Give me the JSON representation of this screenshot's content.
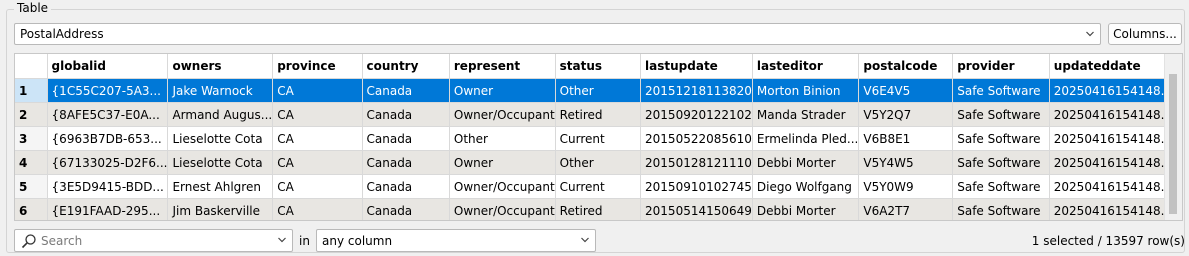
{
  "group_title": "Table",
  "layer_select": {
    "value": "PostalAddress"
  },
  "columns_button": "Columns...",
  "table": {
    "columns": [
      "globalid",
      "owners",
      "province",
      "country",
      "represent",
      "status",
      "lastupdate",
      "lasteditor",
      "postalcode",
      "provider",
      "updateddate"
    ],
    "rows": [
      {
        "num": "1",
        "cells": [
          "{1C55C207-5A3...",
          "Jake Warnock",
          "CA",
          "Canada",
          "Owner",
          "Other",
          "20151218113820",
          "Morton Binion",
          "V6E4V5",
          "Safe Software",
          "20250416154148...."
        ]
      },
      {
        "num": "2",
        "cells": [
          "{8AFE5C37-E0A...",
          "Armand Augus...",
          "CA",
          "Canada",
          "Owner/Occupant",
          "Retired",
          "20150920122102",
          "Manda Strader",
          "V5Y2Q7",
          "Safe Software",
          "20250416154148...."
        ]
      },
      {
        "num": "3",
        "cells": [
          "{6963B7DB-653...",
          "Lieselotte Cota",
          "CA",
          "Canada",
          "Other",
          "Current",
          "20150522085610",
          "Ermelinda Pled...",
          "V6B8E1",
          "Safe Software",
          "20250416154148...."
        ]
      },
      {
        "num": "4",
        "cells": [
          "{67133025-D2F6...",
          "Lieselotte Cota",
          "CA",
          "Canada",
          "Owner",
          "Other",
          "20150128121110",
          "Debbi Morter",
          "V5Y4W5",
          "Safe Software",
          "20250416154148...."
        ]
      },
      {
        "num": "5",
        "cells": [
          "{3E5D9415-BDD...",
          "Ernest Ahlgren",
          "CA",
          "Canada",
          "Owner/Occupant",
          "Current",
          "20150910102745",
          "Diego Wolfgang",
          "V5Y0W9",
          "Safe Software",
          "20250416154148...."
        ]
      },
      {
        "num": "6",
        "cells": [
          "{E191FAAD-295...",
          "Jim Baskerville",
          "CA",
          "Canada",
          "Owner/Occupant",
          "Retired",
          "20150514150649",
          "Debbi Morter",
          "V6A2T7",
          "Safe Software",
          "20250416154148...."
        ]
      }
    ],
    "selected_row": 1
  },
  "search": {
    "placeholder": "Search",
    "value": ""
  },
  "in_label": "in",
  "column_select": {
    "value": "any column"
  },
  "status_text": "1 selected / 13597 row(s)",
  "colors": {
    "selection": "#0078d7",
    "alt_row": "#e8e6e2"
  },
  "icons": {
    "search": "search-icon",
    "dropdown": "chevron-down-icon"
  }
}
